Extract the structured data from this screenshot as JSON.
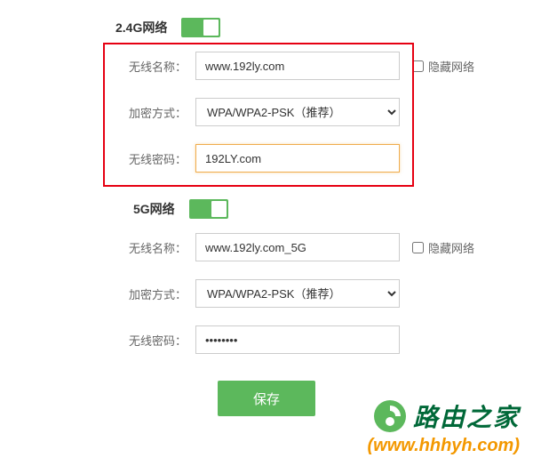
{
  "section_24g": {
    "title": "2.4G网络",
    "toggle_on": true,
    "name_label": "无线名称：",
    "name_value": "www.192ly.com",
    "hide_label": "隐藏网络",
    "encrypt_label": "加密方式：",
    "encrypt_value": "WPA/WPA2-PSK（推荐）",
    "password_label": "无线密码：",
    "password_value": "192LY.com"
  },
  "section_5g": {
    "title": "5G网络",
    "toggle_on": true,
    "name_label": "无线名称：",
    "name_value": "www.192ly.com_5G",
    "hide_label": "隐藏网络",
    "encrypt_label": "加密方式：",
    "encrypt_value": "WPA/WPA2-PSK（推荐）",
    "password_label": "无线密码：",
    "password_value": "••••••••"
  },
  "save_label": "保存",
  "watermark": {
    "brand": "路由之家",
    "url": "(www.hhhyh.com)"
  }
}
